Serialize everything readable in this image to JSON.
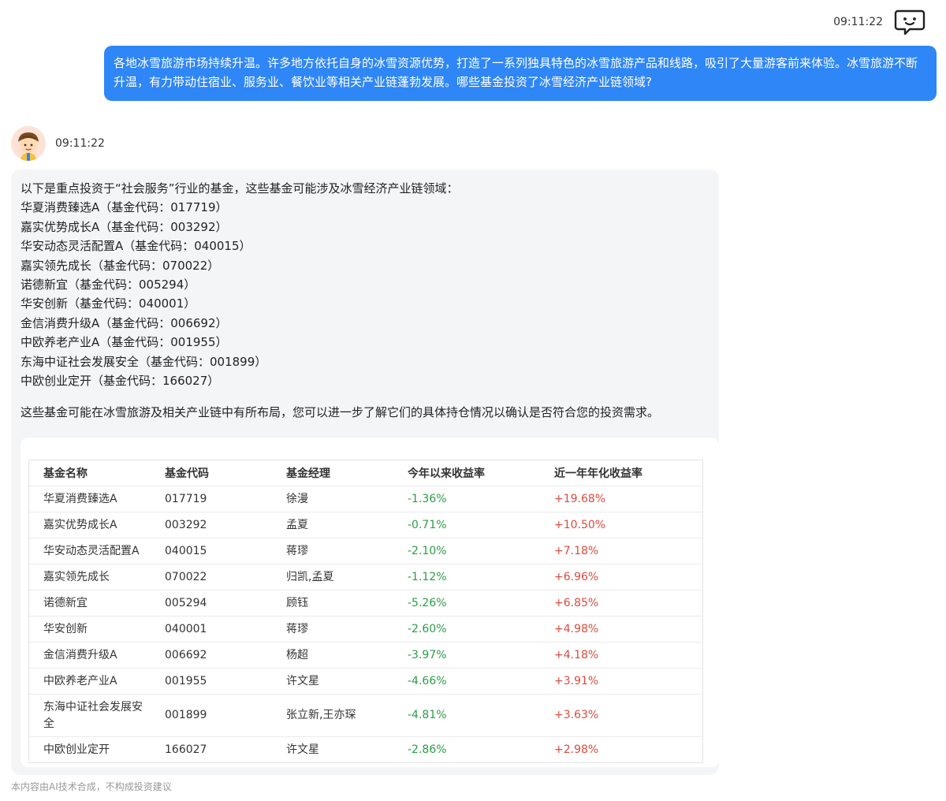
{
  "user": {
    "time": "09:11:22",
    "message": "各地冰雪旅游市场持续升温。许多地方依托自身的冰雪资源优势，打造了一系列独具特色的冰雪旅游产品和线路，吸引了大量游客前来体验。冰雪旅游不断升温，有力带动住宿业、服务业、餐饮业等相关产业链蓬勃发展。哪些基金投资了冰雪经济产业链领域?"
  },
  "assistant": {
    "time": "09:11:22",
    "intro": "以下是重点投资于“社会服务”行业的基金，这些基金可能涉及冰雪经济产业链领域：",
    "fund_lines": [
      "华夏消费臻选A（基金代码：017719）",
      "嘉实优势成长A（基金代码：003292）",
      "华安动态灵活配置A（基金代码：040015）",
      "嘉实领先成长（基金代码：070022）",
      "诺德新宜（基金代码：005294）",
      "华安创新（基金代码：040001）",
      "金信消费升级A（基金代码：006692）",
      "中欧养老产业A（基金代码：001955）",
      "东海中证社会发展安全（基金代码：001899）",
      "中欧创业定开（基金代码：166027）"
    ],
    "closing": "这些基金可能在冰雪旅游及相关产业链中有所布局，您可以进一步了解它们的具体持仓情况以确认是否符合您的投资需求。"
  },
  "table": {
    "headers": [
      "基金名称",
      "基金代码",
      "基金经理",
      "今年以来收益率",
      "近一年年化收益率"
    ],
    "rows": [
      [
        "华夏消费臻选A",
        "017719",
        "徐漫",
        "-1.36%",
        "+19.68%"
      ],
      [
        "嘉实优势成长A",
        "003292",
        "孟夏",
        "-0.71%",
        "+10.50%"
      ],
      [
        "华安动态灵活配置A",
        "040015",
        "蒋璆",
        "-2.10%",
        "+7.18%"
      ],
      [
        "嘉实领先成长",
        "070022",
        "归凯,孟夏",
        "-1.12%",
        "+6.96%"
      ],
      [
        "诺德新宜",
        "005294",
        "顾钰",
        "-5.26%",
        "+6.85%"
      ],
      [
        "华安创新",
        "040001",
        "蒋璆",
        "-2.60%",
        "+4.98%"
      ],
      [
        "金信消费升级A",
        "006692",
        "杨超",
        "-3.97%",
        "+4.18%"
      ],
      [
        "中欧养老产业A",
        "001955",
        "许文星",
        "-4.66%",
        "+3.91%"
      ],
      [
        "东海中证社会发展安全",
        "001899",
        "张立新,王亦琛",
        "-4.81%",
        "+3.63%"
      ],
      [
        "中欧创业定开",
        "166027",
        "许文星",
        "-2.86%",
        "+2.98%"
      ]
    ]
  },
  "disclaimer": "本内容由AI技术合成，不构成投资建议",
  "colors": {
    "user_bubble": "#2f86f6",
    "negative_return": "#2a9d46",
    "positive_return": "#d84c3e",
    "bot_bubble": "#f4f5f7"
  },
  "icons": {
    "top_right": "chat-bot-icon",
    "assistant_avatar": "cartoon-avatar"
  }
}
